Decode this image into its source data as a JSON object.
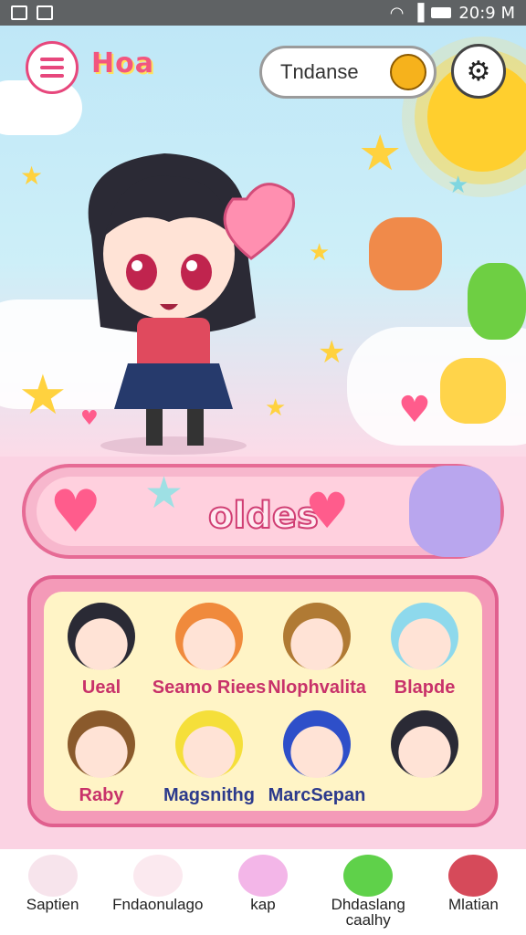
{
  "status_bar": {
    "time": "20:9 M"
  },
  "header": {
    "logo_text": "Hoa",
    "search": {
      "value": "Tndanse"
    }
  },
  "banner": {
    "title": "oldes"
  },
  "characters": [
    {
      "name": "Ueal",
      "color": "#c8326a",
      "hair": "#2a2a35"
    },
    {
      "name": "Seamo Riees",
      "color": "#c8326a",
      "hair": "#f08a3c"
    },
    {
      "name": "Nlophvalita",
      "color": "#c8326a",
      "hair": "#b07a34"
    },
    {
      "name": "Blapde",
      "color": "#c8326a",
      "hair": "#8ed9ec"
    },
    {
      "name": "Raby",
      "color": "#c8326a",
      "hair": "#8a5a2c"
    },
    {
      "name": "Magsnithg",
      "color": "#2c3a8c",
      "hair": "#f5df3a"
    },
    {
      "name": "MarcSepan",
      "color": "#2c3a8c",
      "hair": "#2e4fc9"
    },
    {
      "name": "",
      "color": "#2c3a8c",
      "hair": "#2a2a35"
    }
  ],
  "bottom_nav": [
    {
      "label": "Saptien",
      "icon": "bunny-icon",
      "color": "#f7e4ec"
    },
    {
      "label": "Fndaonulago",
      "icon": "unicorn-icon",
      "color": "#fbe9ef"
    },
    {
      "label": "kap",
      "icon": "character-icon",
      "color": "#f3b6e8"
    },
    {
      "label": "Dhdaslang caalhy",
      "icon": "slime-icon",
      "color": "#5fd14a"
    },
    {
      "label": "Mlatian",
      "icon": "girl-icon",
      "color": "#d64a5a"
    }
  ],
  "colors": {
    "accent": "#e7477c",
    "sky": "#bfe7f7",
    "panel": "#f49ab8"
  }
}
